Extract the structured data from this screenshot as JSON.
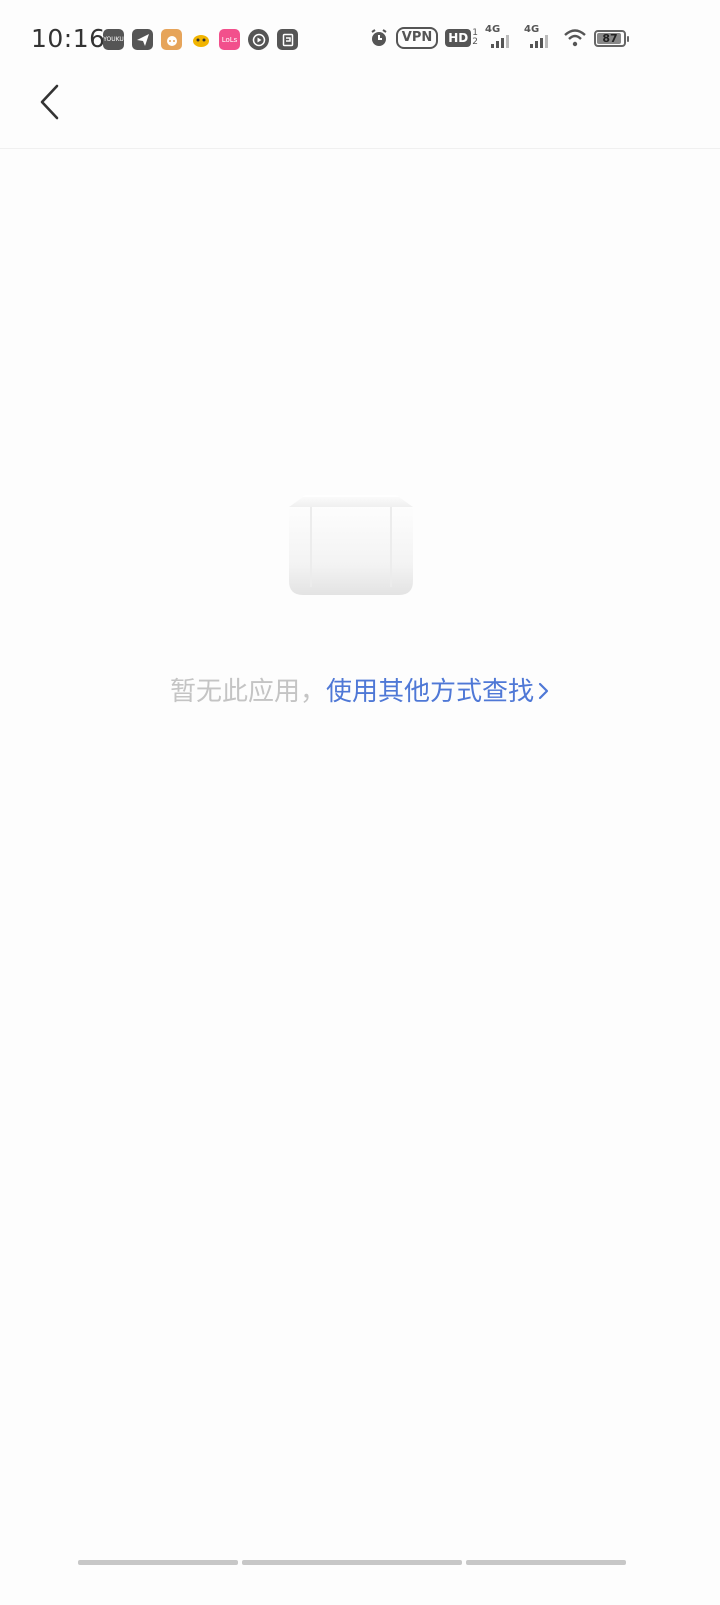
{
  "status_bar": {
    "time": "10:16",
    "app_icons": [
      {
        "name": "youku-icon",
        "color": "#555555",
        "label": "YOUKU"
      },
      {
        "name": "telegram-icon",
        "color": "#555555",
        "label": ""
      },
      {
        "name": "app-cat-icon",
        "color": "#e6a45a",
        "label": ""
      },
      {
        "name": "app-smiley-icon",
        "color": "#f1b400",
        "label": ""
      },
      {
        "name": "lofter-icon",
        "color": "#f2508c",
        "label": "LoLs"
      },
      {
        "name": "play-icon",
        "color": "#555555",
        "label": ""
      },
      {
        "name": "note-icon",
        "color": "#555555",
        "label": ""
      }
    ],
    "vpn_label": "VPN",
    "hd_label": "HD",
    "hd_sub_1": "1",
    "hd_sub_2": "2",
    "signal_1_label": "4G",
    "signal_2_label": "4G",
    "battery_level": "87"
  },
  "empty_state": {
    "message": "暂无此应用，",
    "link_label": "使用其他方式查找"
  },
  "colors": {
    "link": "#4f78d6",
    "muted_text": "#c4c4c4",
    "background": "#fdfdfd"
  }
}
